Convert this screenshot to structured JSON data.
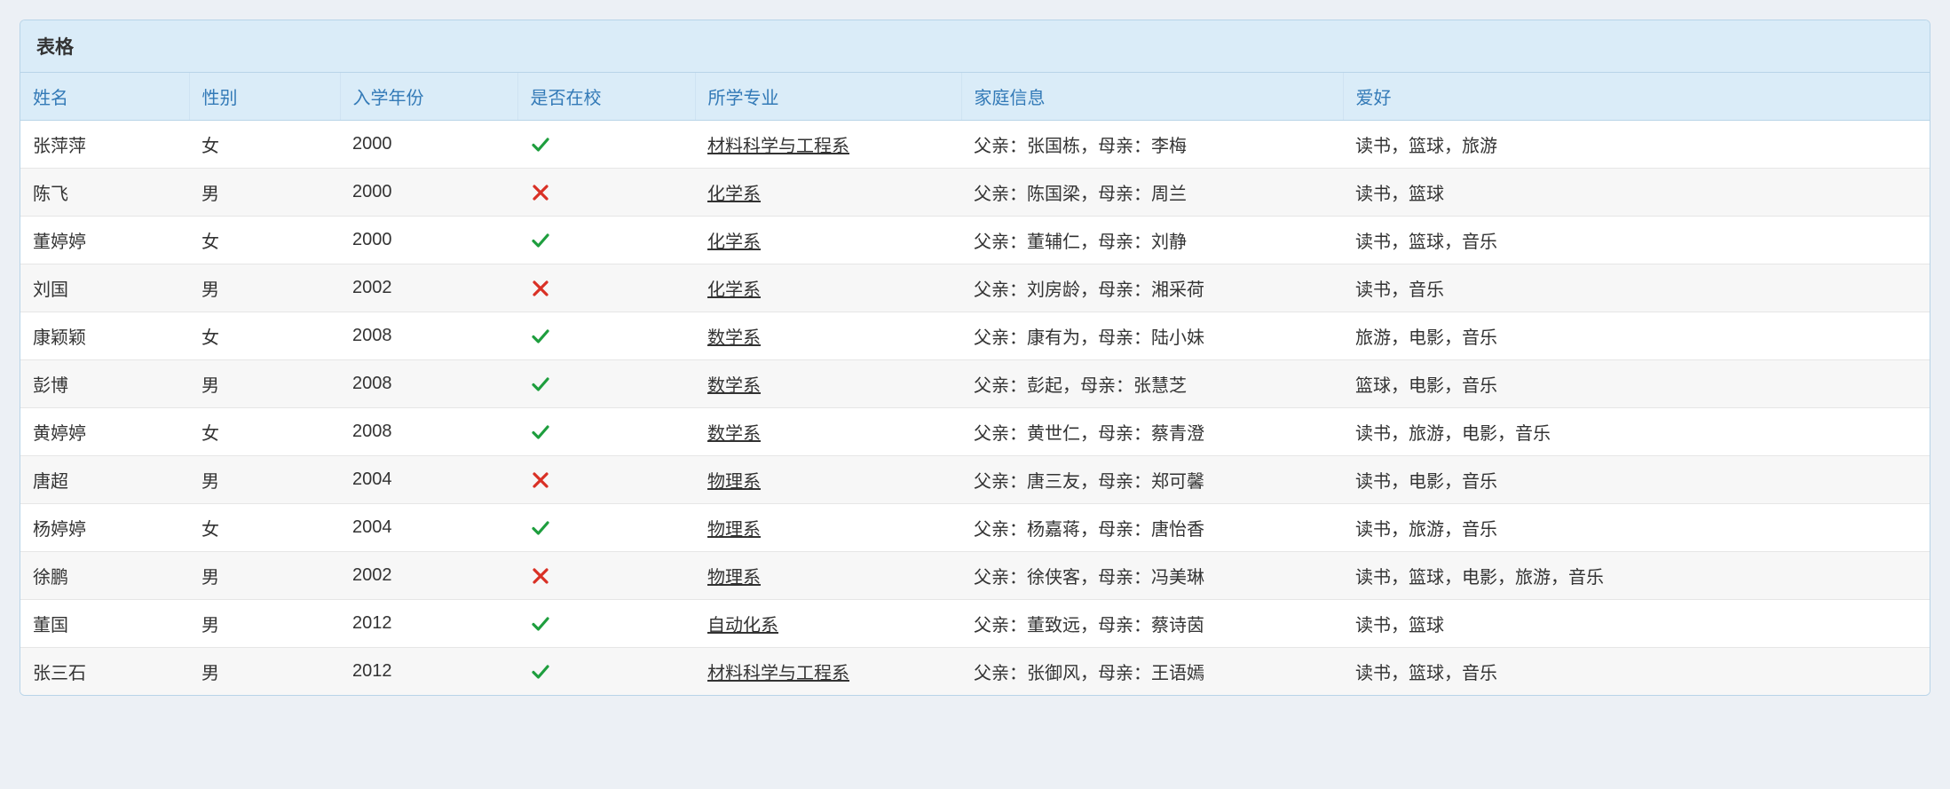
{
  "panel": {
    "title": "表格"
  },
  "columns": {
    "name": "姓名",
    "gender": "性别",
    "year": "入学年份",
    "onCampus": "是否在校",
    "major": "所学专业",
    "family": "家庭信息",
    "hobby": "爱好"
  },
  "rows": [
    {
      "name": "张萍萍",
      "gender": "女",
      "year": "2000",
      "onCampus": true,
      "major": "材料科学与工程系",
      "family": "父亲：张国栋，母亲：李梅",
      "hobby": "读书，篮球，旅游"
    },
    {
      "name": "陈飞",
      "gender": "男",
      "year": "2000",
      "onCampus": false,
      "major": "化学系",
      "family": "父亲：陈国梁，母亲：周兰",
      "hobby": "读书，篮球"
    },
    {
      "name": "董婷婷",
      "gender": "女",
      "year": "2000",
      "onCampus": true,
      "major": "化学系",
      "family": "父亲：董辅仁，母亲：刘静",
      "hobby": "读书，篮球，音乐"
    },
    {
      "name": "刘国",
      "gender": "男",
      "year": "2002",
      "onCampus": false,
      "major": "化学系",
      "family": "父亲：刘房龄，母亲：湘采荷",
      "hobby": "读书，音乐"
    },
    {
      "name": "康颖颖",
      "gender": "女",
      "year": "2008",
      "onCampus": true,
      "major": "数学系",
      "family": "父亲：康有为，母亲：陆小妹",
      "hobby": "旅游，电影，音乐"
    },
    {
      "name": "彭博",
      "gender": "男",
      "year": "2008",
      "onCampus": true,
      "major": "数学系",
      "family": "父亲：彭起，母亲：张慧芝",
      "hobby": "篮球，电影，音乐"
    },
    {
      "name": "黄婷婷",
      "gender": "女",
      "year": "2008",
      "onCampus": true,
      "major": "数学系",
      "family": "父亲：黄世仁，母亲：蔡青澄",
      "hobby": "读书，旅游，电影，音乐"
    },
    {
      "name": "唐超",
      "gender": "男",
      "year": "2004",
      "onCampus": false,
      "major": "物理系",
      "family": "父亲：唐三友，母亲：郑可馨",
      "hobby": "读书，电影，音乐"
    },
    {
      "name": "杨婷婷",
      "gender": "女",
      "year": "2004",
      "onCampus": true,
      "major": "物理系",
      "family": "父亲：杨嘉蒋，母亲：唐怡香",
      "hobby": "读书，旅游，音乐"
    },
    {
      "name": "徐鹏",
      "gender": "男",
      "year": "2002",
      "onCampus": false,
      "major": "物理系",
      "family": "父亲：徐侠客，母亲：冯美琳",
      "hobby": "读书，篮球，电影，旅游，音乐"
    },
    {
      "name": "董国",
      "gender": "男",
      "year": "2012",
      "onCampus": true,
      "major": "自动化系",
      "family": "父亲：董致远，母亲：蔡诗茵",
      "hobby": "读书，篮球"
    },
    {
      "name": "张三石",
      "gender": "男",
      "year": "2012",
      "onCampus": true,
      "major": "材料科学与工程系",
      "family": "父亲：张御风，母亲：王语嫣",
      "hobby": "读书，篮球，音乐"
    }
  ],
  "icons": {
    "check": "check-icon",
    "cross": "cross-icon"
  }
}
